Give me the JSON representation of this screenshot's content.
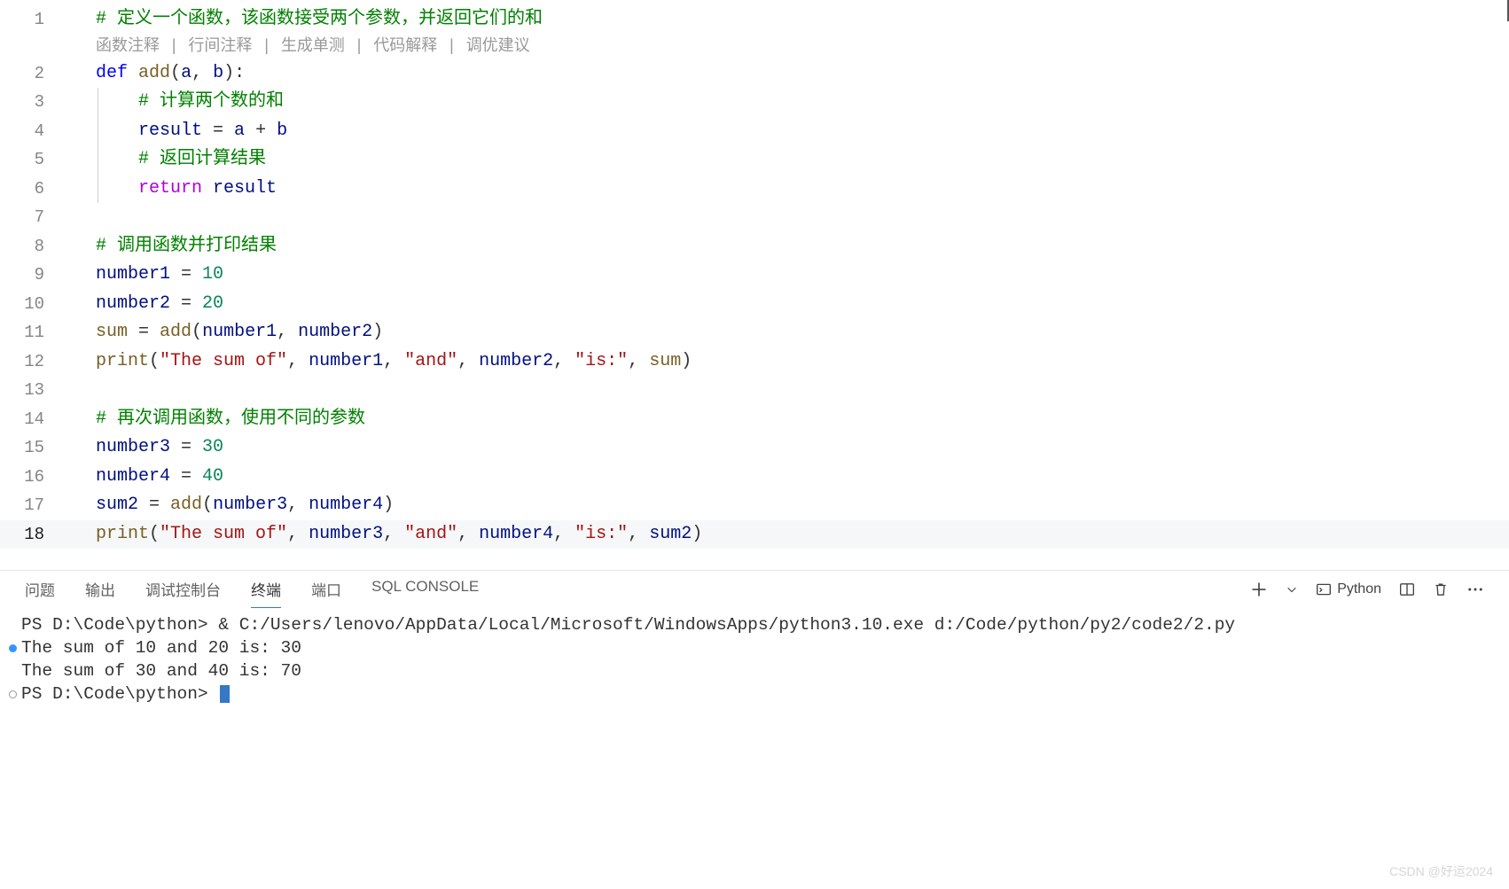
{
  "codelens": {
    "items": [
      "函数注释",
      "行间注释",
      "生成单测",
      "代码解释",
      "调优建议"
    ],
    "sep": " | "
  },
  "code": {
    "lines": [
      {
        "n": 1,
        "tokens": [
          {
            "t": "# 定义一个函数，该函数接受两个参数，并返回它们的和",
            "c": "tok-comment"
          }
        ]
      },
      {
        "n": 2,
        "tokens": [
          {
            "t": "def",
            "c": "tok-keyword-def"
          },
          {
            "t": " "
          },
          {
            "t": "add",
            "c": "tok-funcname"
          },
          {
            "t": "(",
            "c": "tok-punct"
          },
          {
            "t": "a",
            "c": "tok-param"
          },
          {
            "t": ", ",
            "c": "tok-punct"
          },
          {
            "t": "b",
            "c": "tok-param"
          },
          {
            "t": "):",
            "c": "tok-punct"
          }
        ]
      },
      {
        "n": 3,
        "indent": 4,
        "guide": true,
        "tokens": [
          {
            "t": "# 计算两个数的和",
            "c": "tok-comment"
          }
        ]
      },
      {
        "n": 4,
        "indent": 4,
        "guide": true,
        "tokens": [
          {
            "t": "result",
            "c": "tok-var"
          },
          {
            "t": " = ",
            "c": "tok-op"
          },
          {
            "t": "a",
            "c": "tok-var"
          },
          {
            "t": " + ",
            "c": "tok-op"
          },
          {
            "t": "b",
            "c": "tok-var"
          }
        ]
      },
      {
        "n": 5,
        "indent": 4,
        "guide": true,
        "tokens": [
          {
            "t": "# 返回计算结果",
            "c": "tok-comment"
          }
        ]
      },
      {
        "n": 6,
        "indent": 4,
        "guide": true,
        "tokens": [
          {
            "t": "return",
            "c": "tok-keyword-return"
          },
          {
            "t": " "
          },
          {
            "t": "result",
            "c": "tok-var"
          }
        ]
      },
      {
        "n": 7,
        "tokens": []
      },
      {
        "n": 8,
        "tokens": [
          {
            "t": "# 调用函数并打印结果",
            "c": "tok-comment"
          }
        ]
      },
      {
        "n": 9,
        "tokens": [
          {
            "t": "number1",
            "c": "tok-var"
          },
          {
            "t": " = ",
            "c": "tok-op"
          },
          {
            "t": "10",
            "c": "tok-number"
          }
        ]
      },
      {
        "n": 10,
        "tokens": [
          {
            "t": "number2",
            "c": "tok-var"
          },
          {
            "t": " = ",
            "c": "tok-op"
          },
          {
            "t": "20",
            "c": "tok-number"
          }
        ]
      },
      {
        "n": 11,
        "tokens": [
          {
            "t": "sum",
            "c": "tok-builtin"
          },
          {
            "t": " = ",
            "c": "tok-op"
          },
          {
            "t": "add",
            "c": "tok-funccall"
          },
          {
            "t": "(",
            "c": "tok-punct"
          },
          {
            "t": "number1",
            "c": "tok-var"
          },
          {
            "t": ", ",
            "c": "tok-punct"
          },
          {
            "t": "number2",
            "c": "tok-var"
          },
          {
            "t": ")",
            "c": "tok-punct"
          }
        ]
      },
      {
        "n": 12,
        "tokens": [
          {
            "t": "print",
            "c": "tok-builtin"
          },
          {
            "t": "(",
            "c": "tok-punct"
          },
          {
            "t": "\"The sum of\"",
            "c": "tok-string"
          },
          {
            "t": ", ",
            "c": "tok-punct"
          },
          {
            "t": "number1",
            "c": "tok-var"
          },
          {
            "t": ", ",
            "c": "tok-punct"
          },
          {
            "t": "\"and\"",
            "c": "tok-string"
          },
          {
            "t": ", ",
            "c": "tok-punct"
          },
          {
            "t": "number2",
            "c": "tok-var"
          },
          {
            "t": ", ",
            "c": "tok-punct"
          },
          {
            "t": "\"is:\"",
            "c": "tok-string"
          },
          {
            "t": ", ",
            "c": "tok-punct"
          },
          {
            "t": "sum",
            "c": "tok-builtin"
          },
          {
            "t": ")",
            "c": "tok-punct"
          }
        ]
      },
      {
        "n": 13,
        "tokens": []
      },
      {
        "n": 14,
        "tokens": [
          {
            "t": "# 再次调用函数，使用不同的参数",
            "c": "tok-comment"
          }
        ]
      },
      {
        "n": 15,
        "tokens": [
          {
            "t": "number3",
            "c": "tok-var"
          },
          {
            "t": " = ",
            "c": "tok-op"
          },
          {
            "t": "30",
            "c": "tok-number"
          }
        ]
      },
      {
        "n": 16,
        "tokens": [
          {
            "t": "number4",
            "c": "tok-var"
          },
          {
            "t": " = ",
            "c": "tok-op"
          },
          {
            "t": "40",
            "c": "tok-number"
          }
        ]
      },
      {
        "n": 17,
        "tokens": [
          {
            "t": "sum2",
            "c": "tok-var"
          },
          {
            "t": " = ",
            "c": "tok-op"
          },
          {
            "t": "add",
            "c": "tok-funccall"
          },
          {
            "t": "(",
            "c": "tok-punct"
          },
          {
            "t": "number3",
            "c": "tok-var"
          },
          {
            "t": ", ",
            "c": "tok-punct"
          },
          {
            "t": "number4",
            "c": "tok-var"
          },
          {
            "t": ")",
            "c": "tok-punct"
          }
        ]
      },
      {
        "n": 18,
        "active": true,
        "tokens": [
          {
            "t": "print",
            "c": "tok-builtin"
          },
          {
            "t": "(",
            "c": "tok-punct"
          },
          {
            "t": "\"The sum of\"",
            "c": "tok-string"
          },
          {
            "t": ", ",
            "c": "tok-punct"
          },
          {
            "t": "number3",
            "c": "tok-var"
          },
          {
            "t": ", ",
            "c": "tok-punct"
          },
          {
            "t": "\"and\"",
            "c": "tok-string"
          },
          {
            "t": ", ",
            "c": "tok-punct"
          },
          {
            "t": "number4",
            "c": "tok-var"
          },
          {
            "t": ", ",
            "c": "tok-punct"
          },
          {
            "t": "\"is:\"",
            "c": "tok-string"
          },
          {
            "t": ", ",
            "c": "tok-punct"
          },
          {
            "t": "sum2",
            "c": "tok-var"
          },
          {
            "t": ")",
            "c": "tok-punct"
          }
        ]
      }
    ]
  },
  "terminal": {
    "tabs": [
      {
        "label": "问题",
        "id": "problems"
      },
      {
        "label": "输出",
        "id": "output"
      },
      {
        "label": "调试控制台",
        "id": "debug-console"
      },
      {
        "label": "终端",
        "id": "terminal",
        "active": true
      },
      {
        "label": "端口",
        "id": "ports"
      },
      {
        "label": "SQL CONSOLE",
        "id": "sql-console"
      }
    ],
    "lang_label": "Python",
    "cmd_prompt1": "PS D:\\Code\\python> ",
    "cmd_body": "& C:/Users/lenovo/AppData/Local/Microsoft/WindowsApps/python3.10.exe d:/Code/python/py2/code2/2.py",
    "out1": "The sum of 10 and 20 is: 30",
    "out2": "The sum of 30 and 40 is: 70",
    "cmd_prompt2": "PS D:\\Code\\python> "
  },
  "watermark": "CSDN @好运2024"
}
